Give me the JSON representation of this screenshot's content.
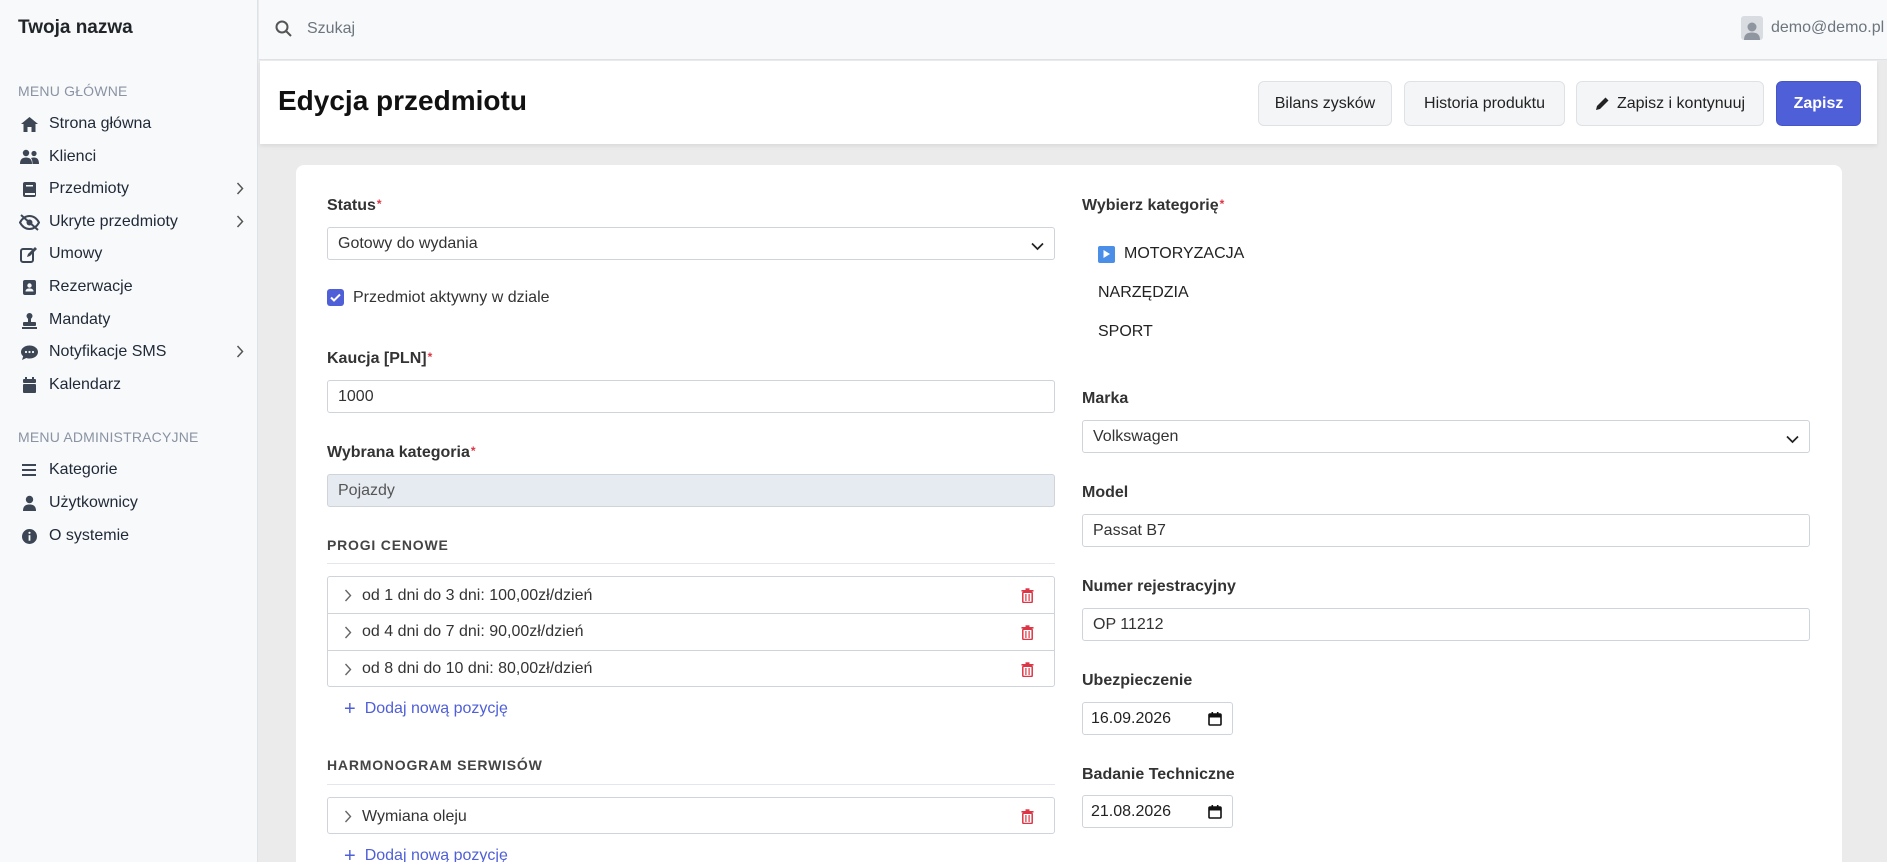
{
  "sidebar": {
    "brand": "Twoja nazwa",
    "main_section_label": "MENU GŁÓWNE",
    "main_items": [
      {
        "label": "Strona główna",
        "icon": "home-icon"
      },
      {
        "label": "Klienci",
        "icon": "users-icon"
      },
      {
        "label": "Przedmioty",
        "icon": "book-icon",
        "has_submenu": true
      },
      {
        "label": "Ukryte przedmioty",
        "icon": "eye-slash-icon",
        "has_submenu": true
      },
      {
        "label": "Umowy",
        "icon": "edit-icon"
      },
      {
        "label": "Rezerwacje",
        "icon": "contact-card-icon"
      },
      {
        "label": "Mandaty",
        "icon": "stamp-icon"
      },
      {
        "label": "Notyfikacje SMS",
        "icon": "sms-icon",
        "has_submenu": true
      },
      {
        "label": "Kalendarz",
        "icon": "calendar-icon"
      }
    ],
    "admin_section_label": "MENU ADMINISTRACYJNE",
    "admin_items": [
      {
        "label": "Kategorie",
        "icon": "list-icon"
      },
      {
        "label": "Użytkownicy",
        "icon": "user-icon"
      },
      {
        "label": "O systemie",
        "icon": "info-icon"
      }
    ]
  },
  "topbar": {
    "search_placeholder": "Szukaj",
    "user_email": "demo@demo.pl"
  },
  "header": {
    "title": "Edycja przedmiotu",
    "buttons": {
      "profit": "Bilans zysków",
      "history": "Historia produktu",
      "save_continue": "Zapisz i kontynuuj",
      "save": "Zapisz"
    }
  },
  "form": {
    "status_label": "Status",
    "status_value": "Gotowy do wydania",
    "active_label": "Przedmiot aktywny w dziale",
    "active_checked": true,
    "deposit_label": "Kaucja [PLN]",
    "deposit_value": "1000",
    "selected_category_label": "Wybrana kategoria",
    "selected_category_value": "Pojazdy",
    "price_section_title": "PROGI CENOWE",
    "price_tiers": [
      "od 1 dni do 3 dni: 100,00zł/dzień",
      "od 4 dni do 7 dni: 90,00zł/dzień",
      "od 8 dni do 10 dni: 80,00zł/dzień"
    ],
    "add_position_label": "Dodaj nową pozycję",
    "service_section_title": "HARMONOGRAM SERWISÓW",
    "services": [
      "Wymiana oleju"
    ],
    "choose_category_label": "Wybierz kategorię",
    "categories": [
      "MOTORYZACJA",
      "NARZĘDZIA",
      "SPORT"
    ],
    "brand_label": "Marka",
    "brand_value": "Volkswagen",
    "model_label": "Model",
    "model_value": "Passat B7",
    "registration_label": "Numer rejestracyjny",
    "registration_value": "OP 11212",
    "insurance_label": "Ubezpieczenie",
    "insurance_value": "16.09.2026",
    "inspection_label": "Badanie Techniczne",
    "inspection_value": "21.08.2026"
  },
  "colors": {
    "accent": "#4f5fd8",
    "danger": "#dc3545",
    "sidebar_bg": "#f8f9fa"
  }
}
